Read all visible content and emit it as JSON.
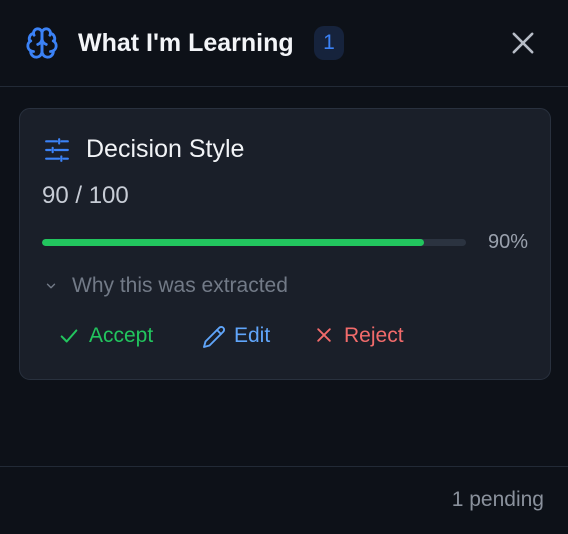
{
  "header": {
    "title": "What I'm Learning",
    "badge_count": "1",
    "icon": "brain-icon",
    "close_icon": "close-icon"
  },
  "card": {
    "icon": "sliders-icon",
    "title": "Decision Style",
    "score": "90 / 100",
    "progress": {
      "value": 0.9,
      "label": "90%"
    },
    "why_toggle": "Why this was extracted",
    "actions": {
      "accept": "Accept",
      "edit": "Edit",
      "reject": "Reject"
    }
  },
  "footer": {
    "status": "1 pending"
  },
  "colors": {
    "background": "#0d1118",
    "card": "#1a1f29",
    "accent_blue": "#3b82f6",
    "success": "#22c55e",
    "danger": "#f26b6b"
  }
}
